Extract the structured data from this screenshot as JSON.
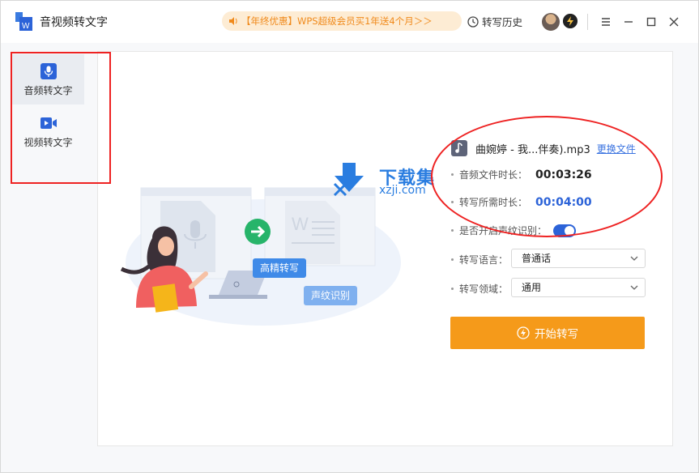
{
  "window": {
    "title": "音视频转文字",
    "promo_text": "【年终优惠】WPS超级会员买1年送4个月＞＞",
    "history_label": "转写历史"
  },
  "sidebar": {
    "items": [
      {
        "label": "音频转文字",
        "icon": "microphone-icon",
        "active": true
      },
      {
        "label": "视频转文字",
        "icon": "video-camera-icon",
        "active": false
      }
    ]
  },
  "illustration": {
    "bubble_hd": "高精转写",
    "bubble_voiceprint": "声纹识别"
  },
  "file": {
    "name": "曲婉婷 - 我...伴奏).mp3",
    "change_label": "更换文件"
  },
  "info": {
    "duration_label": "音频文件时长：",
    "duration_value": "00:03:26",
    "transcribe_label": "转写所需时长：",
    "transcribe_value": "00:04:00",
    "voiceprint_label": "是否开启声纹识别：",
    "voiceprint_enabled": true,
    "language_label": "转写语言：",
    "language_value": "普通话",
    "domain_label": "转写领域：",
    "domain_value": "通用"
  },
  "actions": {
    "start_label": "开始转写"
  },
  "watermark": {
    "title": "下载集",
    "url": "xzji.com"
  },
  "colors": {
    "accent_blue": "#2c63d8",
    "start_orange": "#f59a1a",
    "promo_text": "#f08a1c",
    "promo_bg": "#fdecd4",
    "annotation_red": "#e22222"
  }
}
